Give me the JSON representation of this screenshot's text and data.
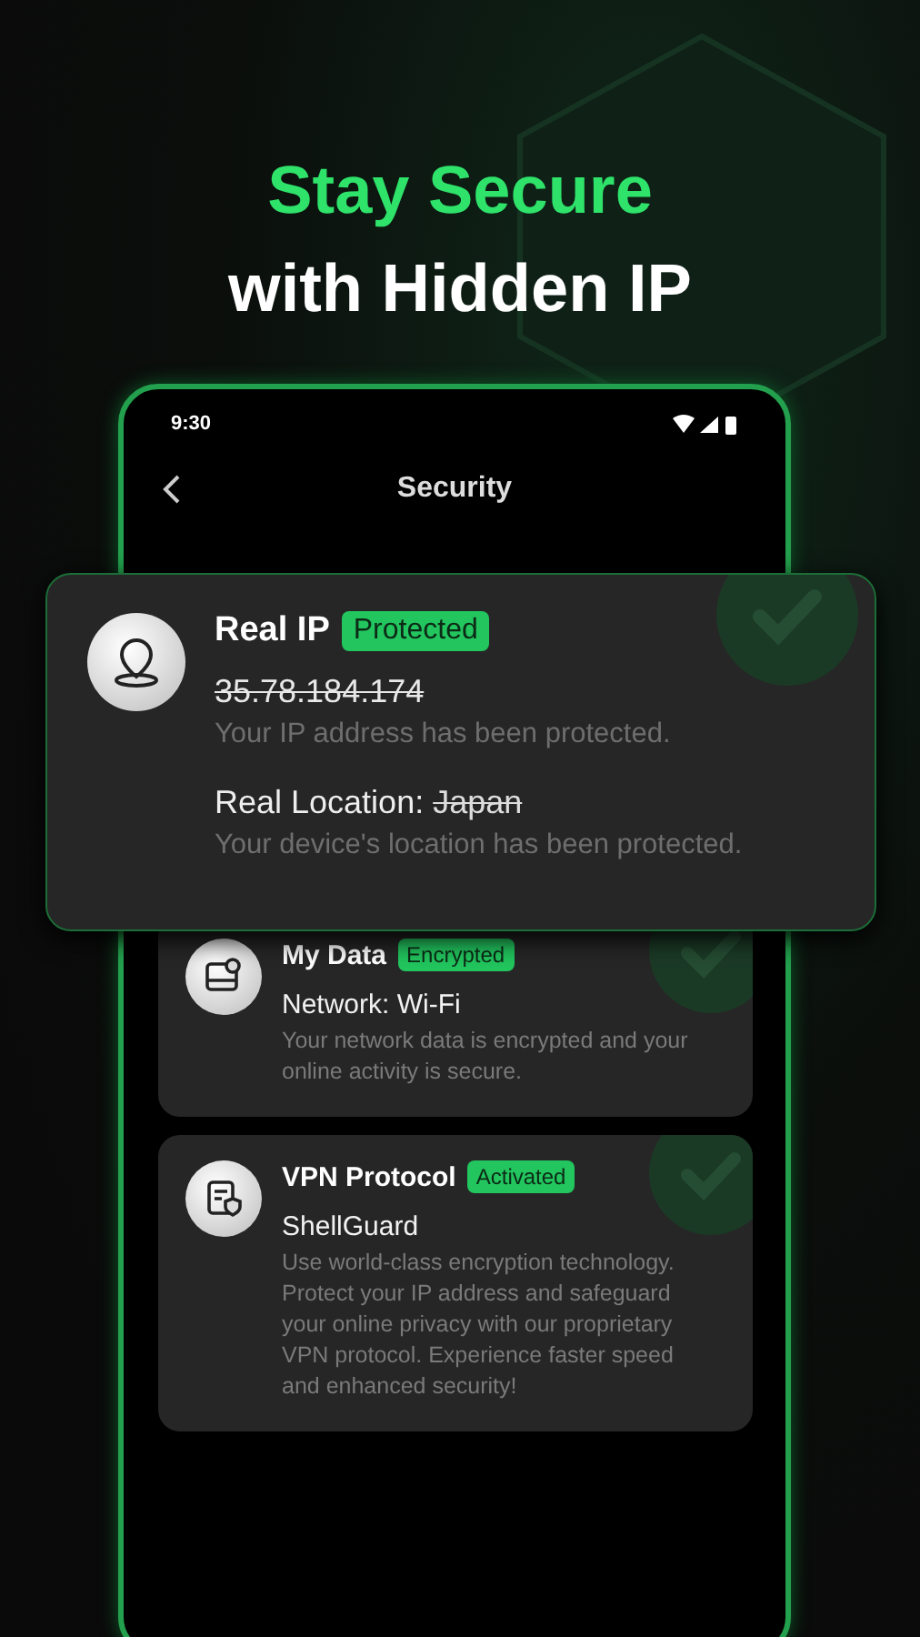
{
  "headline": {
    "accent": "Stay Secure",
    "rest": "with Hidden IP"
  },
  "status_bar": {
    "time": "9:30"
  },
  "header": {
    "title": "Security"
  },
  "featured_card": {
    "title": "Real IP",
    "badge": "Protected",
    "ip": "35.78.184.174",
    "ip_note": "Your IP address has been protected.",
    "location_label": "Real Location:",
    "location_value": "Japan",
    "location_note": "Your device's location has been protected."
  },
  "cards": [
    {
      "kind": "data",
      "title": "My Data",
      "badge": "Encrypted",
      "value": "Network: Wi-Fi",
      "description": "Your network data is encrypted and your online activity is secure."
    },
    {
      "kind": "protocol",
      "title": "VPN Protocol",
      "badge": "Activated",
      "value": "ShellGuard",
      "description": "Use world-class encryption technology. Protect your IP address and safeguard your online privacy with our proprietary VPN protocol. Experience faster speed and enhanced security!"
    }
  ]
}
